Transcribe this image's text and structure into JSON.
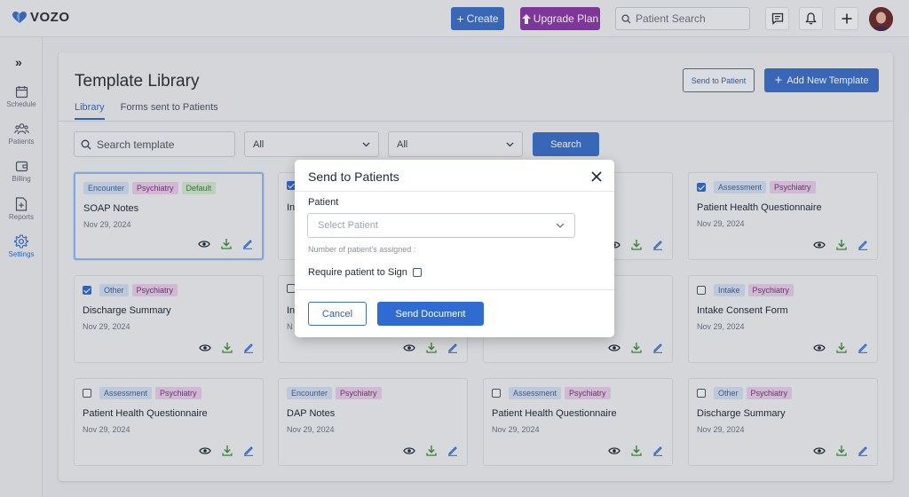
{
  "header": {
    "logo_text": "VOZO",
    "create_label": "Create",
    "upgrade_label": "Upgrade Plan",
    "search_placeholder": "Patient Search"
  },
  "sidebar": {
    "items": [
      {
        "label": "Schedule",
        "icon": "calendar-icon"
      },
      {
        "label": "Patients",
        "icon": "patients-icon"
      },
      {
        "label": "Billing",
        "icon": "wallet-icon"
      },
      {
        "label": "Reports",
        "icon": "report-icon"
      },
      {
        "label": "Settings",
        "icon": "gear-icon"
      }
    ],
    "active": "Settings"
  },
  "page": {
    "title": "Template Library",
    "send_to_patient_label": "Send to Patient",
    "add_template_label": "Add New Template",
    "tabs": [
      {
        "label": "Library",
        "active": true
      },
      {
        "label": "Forms sent to Patients",
        "active": false
      }
    ],
    "search_placeholder": "Search template",
    "filter1_value": "All",
    "filter2_value": "All",
    "search_button": "Search"
  },
  "tag_colors": {
    "Encounter": {
      "bg": "#cfdcef",
      "fg": "#3d5f96"
    },
    "Psychiatry": {
      "bg": "#e4cbe6",
      "fg": "#7a2d83"
    },
    "Default": {
      "bg": "#cfe3cd",
      "fg": "#3f7a3b"
    },
    "Assessment": {
      "bg": "#cfdcef",
      "fg": "#3d5f96"
    },
    "Other": {
      "bg": "#cfdcef",
      "fg": "#3d5f96"
    },
    "Intake": {
      "bg": "#cfdcef",
      "fg": "#3d5f96"
    }
  },
  "cards": [
    {
      "checkbox": "none",
      "tags": [
        "Encounter",
        "Psychiatry",
        "Default"
      ],
      "title": "SOAP Notes",
      "date": "Nov 29, 2024",
      "selected": true
    },
    {
      "checkbox": "checked",
      "tags": [],
      "title": "In",
      "date": "",
      "selected": false
    },
    {
      "checkbox": "none",
      "tags": [],
      "title": "",
      "date": "",
      "selected": false
    },
    {
      "checkbox": "checked",
      "tags": [
        "Assessment",
        "Psychiatry"
      ],
      "title": "Patient Health Questionnaire",
      "date": "Nov 29, 2024",
      "selected": false
    },
    {
      "checkbox": "checked",
      "tags": [
        "Other",
        "Psychiatry"
      ],
      "title": "Discharge Summary",
      "date": "Nov 29, 2024",
      "selected": false
    },
    {
      "checkbox": "unchecked",
      "tags": [],
      "title": "In",
      "date": "N",
      "selected": false
    },
    {
      "checkbox": "none",
      "tags": [],
      "title": "",
      "date": "",
      "selected": false
    },
    {
      "checkbox": "unchecked",
      "tags": [
        "Intake",
        "Psychiatry"
      ],
      "title": "Intake Consent Form",
      "date": "Nov 29, 2024",
      "selected": false
    },
    {
      "checkbox": "unchecked",
      "tags": [
        "Assessment",
        "Psychiatry"
      ],
      "title": "Patient Health Questionnaire",
      "date": "Nov 29, 2024",
      "selected": false
    },
    {
      "checkbox": "none",
      "tags": [
        "Encounter",
        "Psychiatry"
      ],
      "title": "DAP Notes",
      "date": "Nov 29, 2024",
      "selected": false
    },
    {
      "checkbox": "unchecked",
      "tags": [
        "Assessment",
        "Psychiatry"
      ],
      "title": "Patient Health Questionnaire",
      "date": "Nov 29, 2024",
      "selected": false
    },
    {
      "checkbox": "unchecked",
      "tags": [
        "Other",
        "Psychiatry"
      ],
      "title": "Discharge Summary",
      "date": "Nov 29, 2024",
      "selected": false
    }
  ],
  "modal": {
    "title": "Send to Patients",
    "patient_label": "Patient",
    "patient_placeholder": "Select Patient",
    "assigned_note": "Number of patient's assigned :",
    "require_sign_label": "Require patient to Sign",
    "cancel_label": "Cancel",
    "send_label": "Send Document"
  }
}
